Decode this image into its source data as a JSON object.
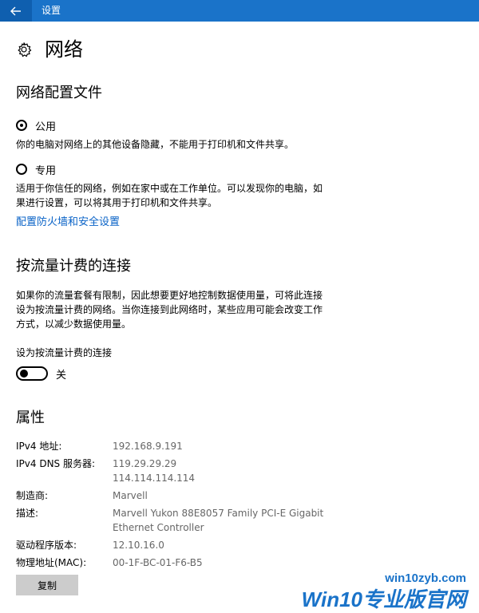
{
  "window": {
    "title": "设置"
  },
  "page": {
    "title": "网络"
  },
  "profile": {
    "heading": "网络配置文件",
    "public_label": "公用",
    "public_desc": "你的电脑对网络上的其他设备隐藏，不能用于打印机和文件共享。",
    "private_label": "专用",
    "private_desc": "适用于你信任的网络，例如在家中或在工作单位。可以发现你的电脑，如果进行设置，可以将其用于打印机和文件共享。",
    "selected": "public",
    "firewall_link": "配置防火墙和安全设置"
  },
  "metered": {
    "heading": "按流量计费的连接",
    "desc": "如果你的流量套餐有限制，因此想要更好地控制数据使用量，可将此连接设为按流量计费的网络。当你连接到此网络时，某些应用可能会改变工作方式，以减少数据使用量。",
    "toggle_label": "设为按流量计费的连接",
    "toggle_state": "关"
  },
  "properties": {
    "heading": "属性",
    "rows": [
      {
        "key": "IPv4 地址:",
        "value": "192.168.9.191"
      },
      {
        "key": "IPv4 DNS 服务器:",
        "value": "119.29.29.29",
        "value2": "114.114.114.114"
      },
      {
        "key": "制造商:",
        "value": "Marvell"
      },
      {
        "key": "描述:",
        "value": "Marvell Yukon 88E8057 Family PCI-E Gigabit",
        "value2": "Ethernet Controller"
      },
      {
        "key": "驱动程序版本:",
        "value": "12.10.16.0"
      },
      {
        "key": "物理地址(MAC):",
        "value": "00-1F-BC-01-F6-B5"
      }
    ],
    "copy_label": "复制"
  },
  "watermark": {
    "url": "win10zyb.com",
    "brand": "Win10专业版官网"
  },
  "colors": {
    "accent": "#1a73c9",
    "link": "#0a63c7",
    "secondary_text": "#666666",
    "button_bg": "#cccccc"
  }
}
